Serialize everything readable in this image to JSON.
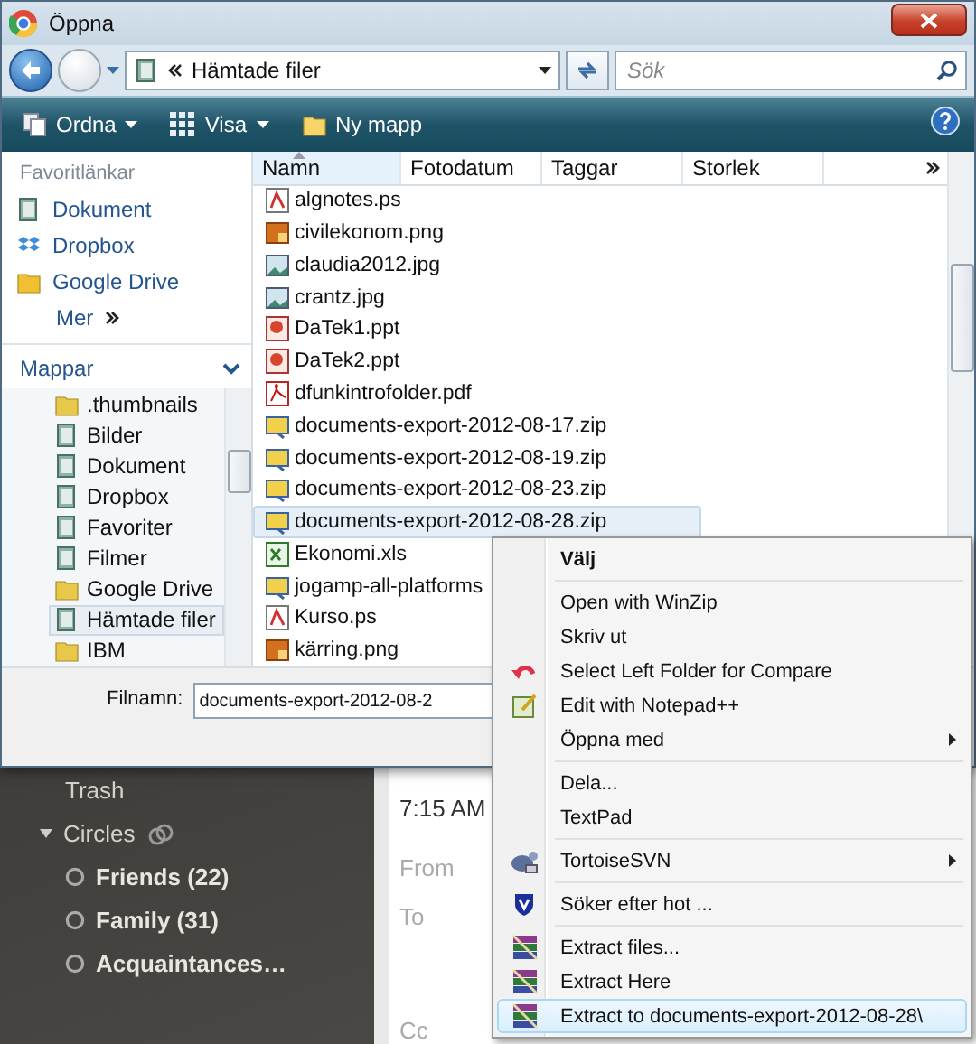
{
  "window": {
    "title": "Öppna"
  },
  "address": {
    "path": "Hämtade filer"
  },
  "search": {
    "placeholder": "Sök"
  },
  "toolbar": [
    {
      "label": "Ordna",
      "kind": "menu"
    },
    {
      "label": "Visa",
      "kind": "menu"
    },
    {
      "label": "Ny mapp",
      "kind": "button"
    }
  ],
  "favorites": {
    "heading": "Favoritlänkar",
    "items": [
      {
        "label": "Dokument"
      },
      {
        "label": "Dropbox"
      },
      {
        "label": "Google Drive"
      }
    ],
    "more": "Mer"
  },
  "folders": {
    "heading": "Mappar",
    "expanded": true,
    "items": [
      {
        "label": ".thumbnails",
        "selected": false
      },
      {
        "label": "Bilder",
        "selected": false
      },
      {
        "label": "Dokument",
        "selected": false
      },
      {
        "label": "Dropbox",
        "selected": false
      },
      {
        "label": "Favoriter",
        "selected": false
      },
      {
        "label": "Filmer",
        "selected": false
      },
      {
        "label": "Google Drive",
        "selected": false
      },
      {
        "label": "Hämtade filer",
        "selected": true
      },
      {
        "label": "IBM",
        "selected": false
      }
    ]
  },
  "columns": [
    {
      "label": "Namn",
      "sorted": true
    },
    {
      "label": "Fotodatum",
      "sorted": false
    },
    {
      "label": "Taggar",
      "sorted": false
    },
    {
      "label": "Storlek",
      "sorted": false
    }
  ],
  "files": [
    {
      "name": "algnotes.ps",
      "kind": "ps",
      "selected": false
    },
    {
      "name": "civilekonom.png",
      "kind": "png",
      "selected": false
    },
    {
      "name": "claudia2012.jpg",
      "kind": "jpg",
      "selected": false
    },
    {
      "name": "crantz.jpg",
      "kind": "jpg",
      "selected": false
    },
    {
      "name": "DaTek1.ppt",
      "kind": "ppt",
      "selected": false
    },
    {
      "name": "DaTek2.ppt",
      "kind": "ppt",
      "selected": false
    },
    {
      "name": "dfunkintrofolder.pdf",
      "kind": "pdf",
      "selected": false
    },
    {
      "name": "documents-export-2012-08-17.zip",
      "kind": "zip",
      "selected": false
    },
    {
      "name": "documents-export-2012-08-19.zip",
      "kind": "zip",
      "selected": false
    },
    {
      "name": "documents-export-2012-08-23.zip",
      "kind": "zip",
      "selected": false
    },
    {
      "name": "documents-export-2012-08-28.zip",
      "kind": "zip",
      "selected": true
    },
    {
      "name": "Ekonomi.xls",
      "kind": "xls",
      "selected": false
    },
    {
      "name": "jogamp-all-platforms",
      "kind": "zip",
      "selected": false
    },
    {
      "name": "Kurso.ps",
      "kind": "ps",
      "selected": false
    },
    {
      "name": "kärring.png",
      "kind": "png",
      "selected": false
    }
  ],
  "filename": {
    "label": "Filnamn:",
    "value": "documents-export-2012-08-2"
  },
  "background": {
    "nav": [
      {
        "label": "Trash",
        "kind": "link"
      },
      {
        "label": "Circles",
        "kind": "group"
      },
      {
        "label": "Friends (22)",
        "kind": "circle"
      },
      {
        "label": "Family (31)",
        "kind": "circle"
      },
      {
        "label": "Acquaintances…",
        "kind": "circle"
      }
    ],
    "message": {
      "time": "7:15 AM",
      "fields": [
        "From",
        "To",
        "Cc"
      ]
    }
  },
  "context_menu": [
    [
      {
        "label": "Välj",
        "kind": "default",
        "selected": false
      }
    ],
    [
      {
        "label": "Open with WinZip",
        "kind": "plain",
        "selected": false
      },
      {
        "label": "Skriv ut",
        "kind": "plain",
        "selected": false
      },
      {
        "label": "Select Left Folder for Compare",
        "kind": "plain",
        "selected": false
      },
      {
        "label": "Edit with Notepad++",
        "kind": "plain",
        "selected": false
      },
      {
        "label": "Öppna med",
        "kind": "submenu",
        "selected": false
      }
    ],
    [
      {
        "label": "Dela...",
        "kind": "plain",
        "selected": false
      },
      {
        "label": "TextPad",
        "kind": "plain",
        "selected": false
      }
    ],
    [
      {
        "label": "TortoiseSVN",
        "kind": "submenu",
        "selected": false
      }
    ],
    [
      {
        "label": "Söker efter hot ...",
        "kind": "plain",
        "selected": false
      }
    ],
    [
      {
        "label": "Extract files...",
        "kind": "plain",
        "selected": false
      },
      {
        "label": "Extract Here",
        "kind": "plain",
        "selected": false
      },
      {
        "label": "Extract to documents-export-2012-08-28\\",
        "kind": "plain",
        "selected": true
      }
    ]
  ]
}
